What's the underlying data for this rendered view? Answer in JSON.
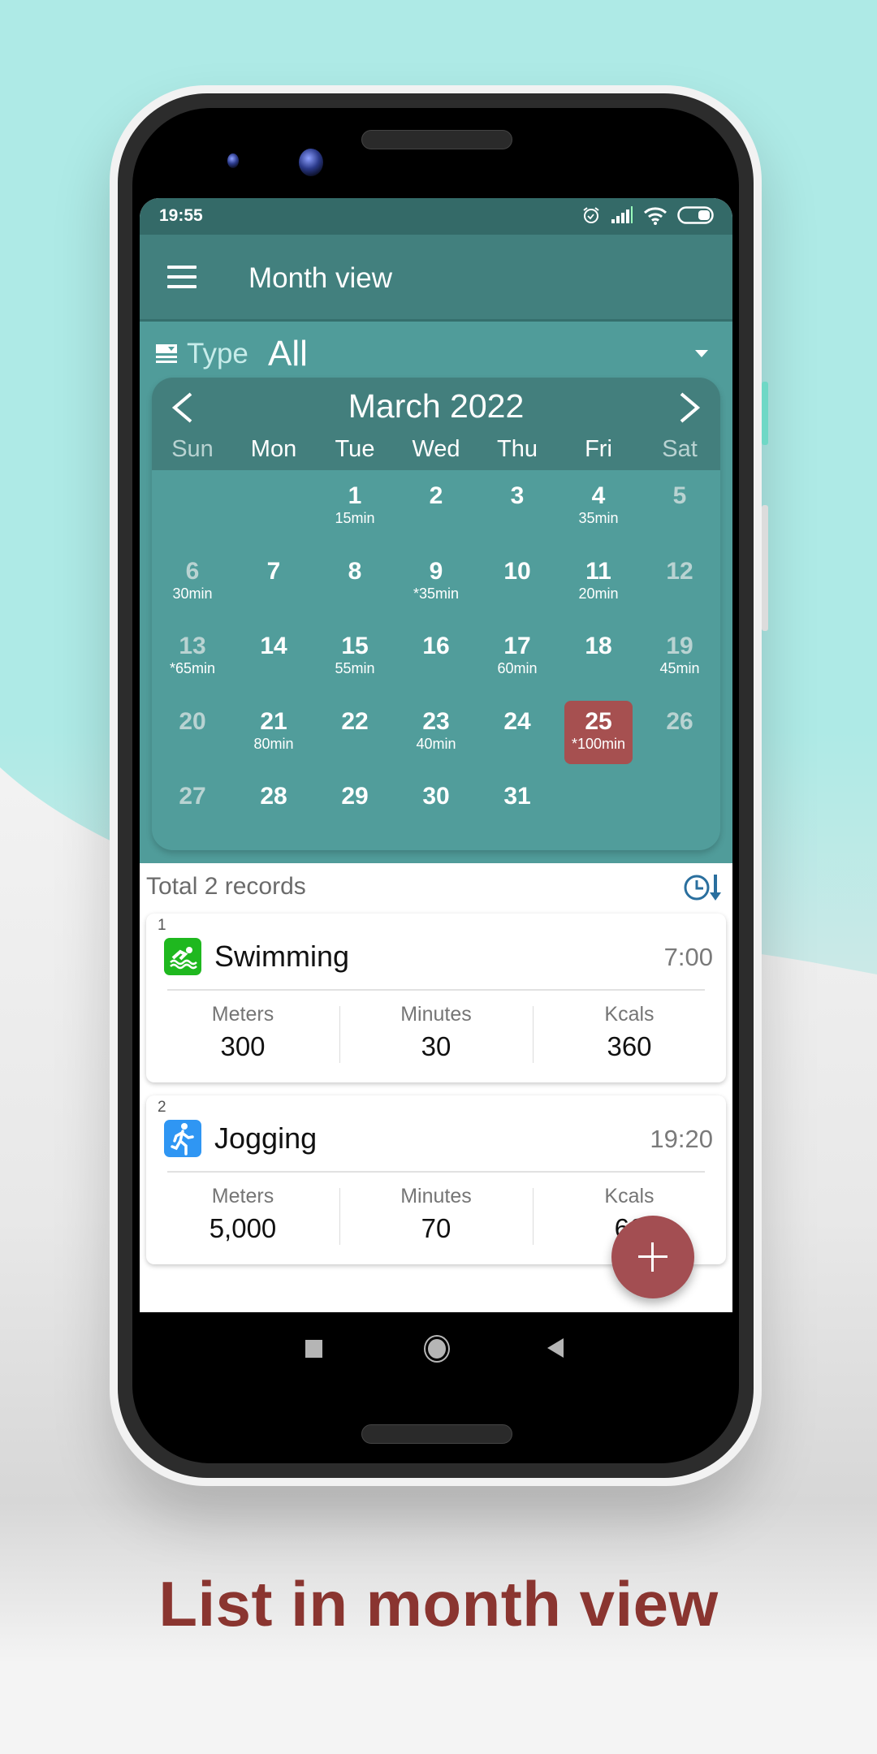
{
  "colors": {
    "status_bar": "#346a68",
    "app_bar": "#42807e",
    "filter_bg": "#509c9a",
    "calendar_header": "#437f7d",
    "selected_day": "#a65050",
    "fab": "#a34e52",
    "caption": "#8a3530",
    "swimming_icon_bg": "#1fb81f",
    "jogging_icon_bg": "#2f96f3",
    "sort_icon": "#2a6f9e"
  },
  "status_bar": {
    "time": "19:55",
    "icons": [
      "alarm-icon",
      "signal-icon",
      "wifi-icon",
      "battery-icon"
    ]
  },
  "app_bar": {
    "menu_icon": "hamburger-menu-icon",
    "title": "Month view"
  },
  "filter": {
    "label": "Type",
    "value": "All",
    "icon": "type-filter-icon"
  },
  "calendar": {
    "month_label": "March 2022",
    "prev_label": "<",
    "next_label": ">",
    "weekdays": [
      "Sun",
      "Mon",
      "Tue",
      "Wed",
      "Thu",
      "Fri",
      "Sat"
    ],
    "selected_day": 25,
    "weeks": [
      [
        {
          "day": ""
        },
        {
          "day": ""
        },
        {
          "day": "1",
          "minutes": "15min"
        },
        {
          "day": "2"
        },
        {
          "day": "3"
        },
        {
          "day": "4",
          "minutes": "35min"
        },
        {
          "day": "5"
        }
      ],
      [
        {
          "day": "6",
          "minutes": "30min"
        },
        {
          "day": "7"
        },
        {
          "day": "8"
        },
        {
          "day": "9",
          "minutes": "*35min"
        },
        {
          "day": "10"
        },
        {
          "day": "11",
          "minutes": "20min"
        },
        {
          "day": "12"
        }
      ],
      [
        {
          "day": "13",
          "minutes": "*65min"
        },
        {
          "day": "14"
        },
        {
          "day": "15",
          "minutes": "55min"
        },
        {
          "day": "16"
        },
        {
          "day": "17",
          "minutes": "60min"
        },
        {
          "day": "18"
        },
        {
          "day": "19",
          "minutes": "45min"
        }
      ],
      [
        {
          "day": "20"
        },
        {
          "day": "21",
          "minutes": "80min"
        },
        {
          "day": "22"
        },
        {
          "day": "23",
          "minutes": "40min"
        },
        {
          "day": "24"
        },
        {
          "day": "25",
          "minutes": "*100min"
        },
        {
          "day": "26"
        }
      ],
      [
        {
          "day": "27"
        },
        {
          "day": "28"
        },
        {
          "day": "29"
        },
        {
          "day": "30"
        },
        {
          "day": "31"
        },
        {
          "day": ""
        },
        {
          "day": ""
        }
      ]
    ]
  },
  "list": {
    "total_text": "Total 2 records",
    "sort_icon": "sort-by-time-icon",
    "records": [
      {
        "index": "1",
        "activity": "Swimming",
        "icon": "swimming-icon",
        "time": "7:00",
        "stats": [
          {
            "label": "Meters",
            "value": "300"
          },
          {
            "label": "Minutes",
            "value": "30"
          },
          {
            "label": "Kcals",
            "value": "360"
          }
        ]
      },
      {
        "index": "2",
        "activity": "Jogging",
        "icon": "running-icon",
        "time": "19:20",
        "stats": [
          {
            "label": "Meters",
            "value": "5,000"
          },
          {
            "label": "Minutes",
            "value": "70"
          },
          {
            "label": "Kcals",
            "value": "66"
          }
        ]
      }
    ]
  },
  "fab": {
    "icon": "plus-icon"
  },
  "nav_bar": {
    "icons": [
      "recent-apps-icon",
      "home-icon",
      "back-icon"
    ]
  },
  "caption": "List in month view"
}
